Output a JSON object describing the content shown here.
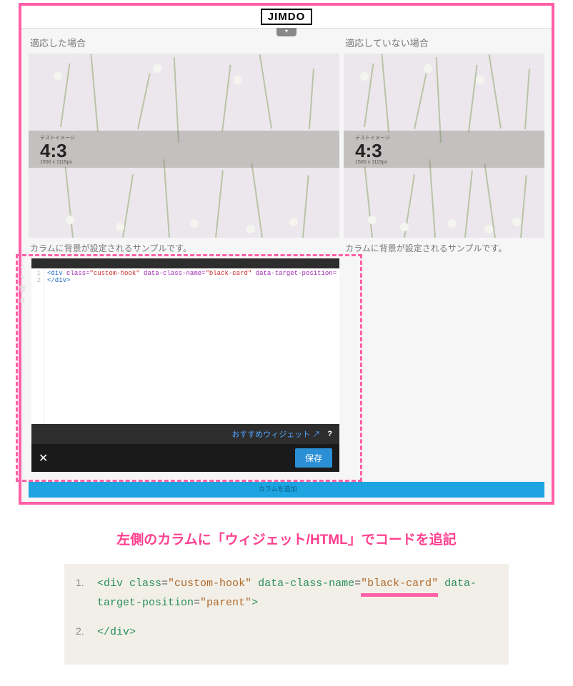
{
  "brand": "JIMDO",
  "left_col_title": "適応した場合",
  "right_col_title": "適応していない場合",
  "ratio_label": "テストイメージ",
  "ratio_text": "4:3",
  "ratio_dims": "1500 x 1115px",
  "caption": "カラムに背景が設定されるサンプルです。",
  "editor": {
    "line1_open": "<div",
    "line1_class_attr": "class=",
    "line1_class_val": "\"custom-hook\"",
    "line1_dcn_attr": "data-class-name=",
    "line1_dcn_val": "\"black-card\"",
    "line1_dtp_attr": "data-target-position=",
    "line2": "</div>",
    "gutter1": "1",
    "gutter2": "2",
    "widget_label": "おすすめウィジェット",
    "help": "?",
    "close": "✕",
    "save": "保存"
  },
  "bluebar_hint": "カラムを追加",
  "instruction": "左側のカラムに「ウィジェット/HTML」でコードを追記",
  "snippet": {
    "row1_num": "1.",
    "row1_open": "<div ",
    "row1_class_k": "class",
    "row1_eq": "=",
    "row1_class_v": "\"custom-hook\"",
    "row1_dcn_k": " data-class-name",
    "row1_dcn_v_a": "\"black-",
    "row1_dcn_v_b": "card\"",
    "row1_dtp_k": " data-target-position",
    "row1_dtp_v": "\"parent\"",
    "row1_close": ">",
    "row2_num": "2.",
    "row2_text": "</div>"
  }
}
